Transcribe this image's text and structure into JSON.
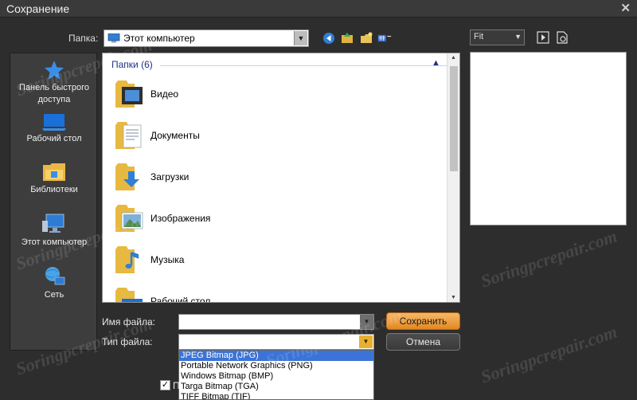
{
  "window": {
    "title": "Сохранение",
    "close_glyph": "✕"
  },
  "location": {
    "label": "Папка:",
    "value": "Этот компьютер"
  },
  "toolbar": {
    "icons": [
      "back-arrow-icon",
      "up-folder-icon",
      "new-folder-icon",
      "view-menu-icon"
    ]
  },
  "places": [
    {
      "label": "Панель быстрого доступа",
      "icon": "star-icon"
    },
    {
      "label": "Рабочий стол",
      "icon": "desktop-icon"
    },
    {
      "label": "Библиотеки",
      "icon": "libraries-icon"
    },
    {
      "label": "Этот компьютер",
      "icon": "computer-icon"
    },
    {
      "label": "Сеть",
      "icon": "network-icon"
    }
  ],
  "browser": {
    "group_header": "Папки (6)",
    "items": [
      {
        "name": "Видео",
        "icon": "video-folder-icon"
      },
      {
        "name": "Документы",
        "icon": "documents-folder-icon"
      },
      {
        "name": "Загрузки",
        "icon": "downloads-folder-icon"
      },
      {
        "name": "Изображения",
        "icon": "pictures-folder-icon"
      },
      {
        "name": "Музыка",
        "icon": "music-folder-icon"
      },
      {
        "name": "Рабочий стол",
        "icon": "desktop-folder-icon"
      }
    ]
  },
  "preview": {
    "fit_value": "Fit"
  },
  "form": {
    "filename_label": "Имя файла:",
    "filename_value": "",
    "filetype_label": "Тип файла:",
    "filetype_value": "JPEG Bitmap (JPG)",
    "filetype_options": [
      "JPEG Bitmap (JPG)",
      "Portable Network Graphics (PNG)",
      "Windows Bitmap (BMP)",
      "Targa Bitmap (TGA)",
      "TIFF Bitmap (TIF)"
    ],
    "checkbox_checked": true,
    "checkbox_label": "П"
  },
  "buttons": {
    "save": "Сохранить",
    "cancel": "Отмена"
  },
  "watermark": "Soringpcrepair.com",
  "colors": {
    "accent": "#e38820",
    "selection": "#3b73d6",
    "group_header": "#1e3287"
  }
}
